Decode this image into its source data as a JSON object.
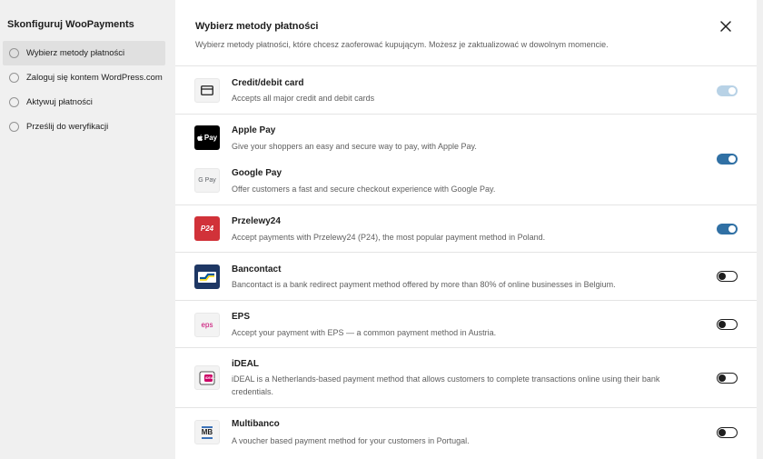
{
  "sidebar": {
    "title": "Skonfiguruj WooPayments",
    "steps": [
      {
        "label": "Wybierz metody płatności"
      },
      {
        "label": "Zaloguj się kontem WordPress.com"
      },
      {
        "label": "Aktywuj płatności"
      },
      {
        "label": "Prześlij do weryfikacji"
      }
    ]
  },
  "header": {
    "title": "Wybierz metody płatności",
    "subtitle": "Wybierz metody płatności, które chcesz zaoferować kupującym. Możesz je zaktualizować w dowolnym momencie."
  },
  "logos": {
    "apple": "Pay",
    "gpay": "G Pay",
    "p24": "P24",
    "eps": "eps",
    "ideal": "iDEAL",
    "mb": "MB"
  },
  "methods": [
    {
      "name": "Credit/debit card",
      "desc": "Accepts all major credit and debit cards",
      "state": "on-disabled"
    },
    {
      "name": "Apple Pay",
      "desc": "Give your shoppers an easy and secure way to pay, with Apple Pay.",
      "state": "on"
    },
    {
      "name": "Google Pay",
      "desc": "Offer customers a fast and secure checkout experience with Google Pay.",
      "state": "on"
    },
    {
      "name": "Przelewy24",
      "desc": "Accept payments with Przelewy24 (P24), the most popular payment method in Poland.",
      "state": "on"
    },
    {
      "name": "Bancontact",
      "desc": "Bancontact is a bank redirect payment method offered by more than 80% of online businesses in Belgium.",
      "state": "off"
    },
    {
      "name": "EPS",
      "desc": "Accept your payment with EPS — a common payment method in Austria.",
      "state": "off"
    },
    {
      "name": "iDEAL",
      "desc": "iDEAL is a Netherlands-based payment method that allows customers to complete transactions online using their bank credentials.",
      "state": "off"
    },
    {
      "name": "Multibanco",
      "desc": "A voucher based payment method for your customers in Portugal.",
      "state": "off"
    }
  ],
  "colors": {
    "accent": "#3070a4",
    "accent_disabled": "#b8d2e6",
    "p24_brand": "#d13239",
    "bancontact_brand": "#1e3764",
    "eps_brand": "#c8036f",
    "ideal_brand": "#cc0066"
  }
}
